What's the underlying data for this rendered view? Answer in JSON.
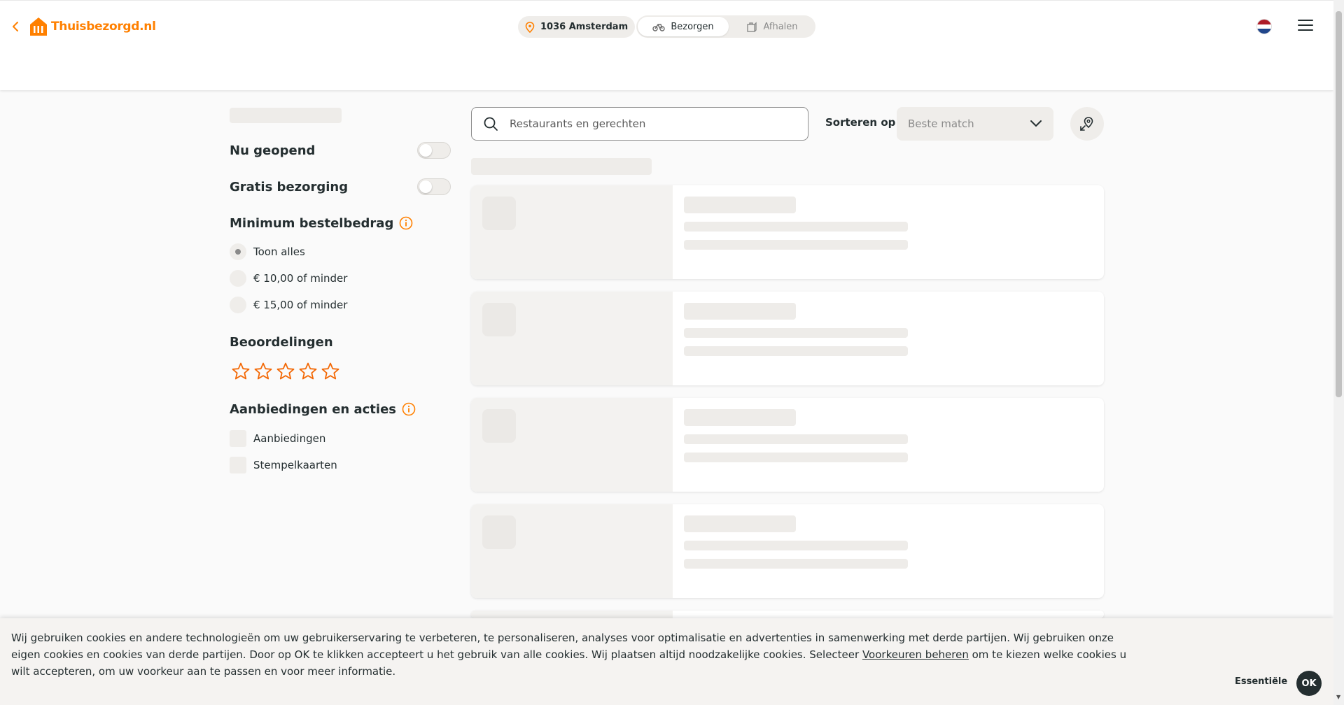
{
  "header": {
    "brand": "Thuisbezorgd.nl",
    "location": "1036 Amsterdam",
    "mode_options": [
      {
        "label": "Bezorgen",
        "active": true
      },
      {
        "label": "Afhalen",
        "active": false
      }
    ],
    "language": "nl"
  },
  "filters": {
    "open_now": {
      "label": "Nu geopend",
      "on": false
    },
    "free_delivery": {
      "label": "Gratis bezorging",
      "on": false
    },
    "min_order": {
      "title": "Minimum bestelbedrag",
      "options": [
        {
          "label": "Toon alles",
          "selected": true
        },
        {
          "label": "€ 10,00 of minder",
          "selected": false
        },
        {
          "label": "€ 15,00 of minder",
          "selected": false
        }
      ]
    },
    "ratings": {
      "title": "Beoordelingen",
      "stars_selected": 0,
      "stars_total": 5
    },
    "offers": {
      "title": "Aanbiedingen en acties",
      "options": [
        {
          "label": "Aanbiedingen",
          "checked": false
        },
        {
          "label": "Stempelkaarten",
          "checked": false
        }
      ]
    }
  },
  "search": {
    "placeholder": "Restaurants en gerechten",
    "value": ""
  },
  "sort": {
    "label": "Sorteren op",
    "value": "Beste match"
  },
  "cookie": {
    "text_before": "Wij gebruiken cookies en andere technologieën om uw gebruikerservaring te verbeteren, te personaliseren, analyses voor optimalisatie en advertenties in samenwerking met derde partijen. Wij gebruiken onze eigen cookies en cookies van derde partijen. Door op OK te klikken accepteert u het gebruik van alle cookies. Wij plaatsen altijd noodzakelijke cookies. Selecteer ",
    "link": "Voorkeuren beheren",
    "text_after": " om te kiezen welke cookies u wilt accepteren, om uw voorkeur aan te passen en voor meer informatie.",
    "essential_button": "Essentiële",
    "ok_button": "OK"
  },
  "colors": {
    "brand": "#ff8000",
    "text": "#242e30",
    "skeleton": "#eeece9"
  }
}
